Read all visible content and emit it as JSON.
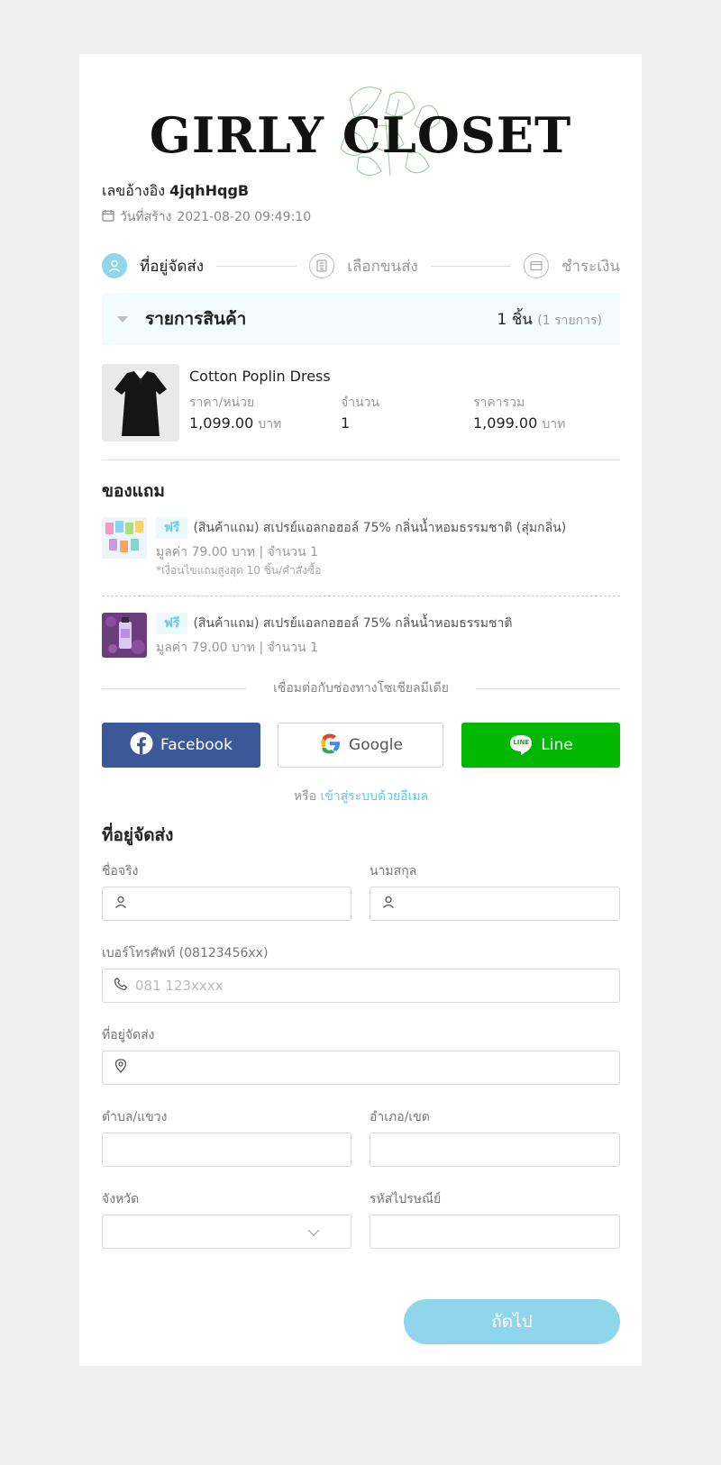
{
  "brand": {
    "logo_text": "GIRLY CLOSET"
  },
  "order": {
    "ref_label": "เลขอ้างอิง",
    "ref_value": "4jqhHqgB",
    "created_label": "วันที่สร้าง",
    "created_value": "2021-08-20 09:49:10"
  },
  "steps": [
    {
      "label": "ที่อยู่จัดส่ง",
      "state": "active"
    },
    {
      "label": "เลือกขนส่ง",
      "state": "pending"
    },
    {
      "label": "ชำระเงิน",
      "state": "pending"
    }
  ],
  "summary": {
    "title": "รายการสินค้า",
    "count": "1 ชิ้น",
    "items": "(1 รายการ)"
  },
  "product": {
    "name": "Cotton Poplin Dress",
    "unit_price_label": "ราคา/หน่วย",
    "unit_price": "1,099.00",
    "qty_label": "จำนวน",
    "qty": "1",
    "total_label": "ราคารวม",
    "total": "1,099.00",
    "currency": "บาท"
  },
  "gifts": {
    "title": "ของแถม",
    "badge": "ฟรี",
    "items": [
      {
        "name": "(สินค้าแถม) สเปรย์แอลกอฮอล์ 75% กลิ่นน้ำหอมธรรมชาติ (สุ่มกลิ่น)",
        "sub": "มูลค่า 79.00 บาท | จำนวน 1",
        "note": "*เงื่อนไขแถมสูงสุด 10 ชิ้น/คำสั่งซื้อ"
      },
      {
        "name": "(สินค้าแถม) สเปรย์แอลกอฮอล์ 75% กลิ่นน้ำหอมธรรมชาติ",
        "sub": "มูลค่า 79.00 บาท | จำนวน 1"
      }
    ]
  },
  "social": {
    "title": "เชื่อมต่อกับช่องทางโซเชียลมีเดีย",
    "facebook": "Facebook",
    "google": "Google",
    "line": "Line",
    "line_icon_text": "LINE",
    "or": "หรือ",
    "email_link": "เข้าสู่ระบบด้วยอีเมล",
    "colors": {
      "facebook": "#3b5898",
      "line": "#00b900",
      "accent": "#8fd6ec"
    }
  },
  "address_form": {
    "title": "ที่อยู่จัดส่ง",
    "first_name_label": "ชื่อจริง",
    "last_name_label": "นามสกุล",
    "phone_label": "เบอร์โทรศัพท์ (08123456xx)",
    "phone_placeholder": "081 123xxxx",
    "address_label": "ที่อยู่จัดส่ง",
    "subdistrict_label": "ตำบล/แขวง",
    "district_label": "อำเภอ/เขต",
    "province_label": "จังหวัด",
    "postcode_label": "รหัสไปรษณีย์",
    "next_button": "ถัดไป"
  }
}
